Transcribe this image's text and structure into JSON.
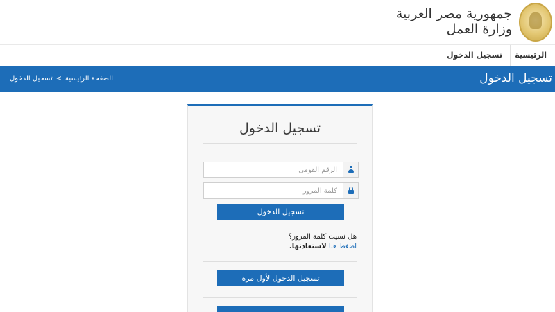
{
  "header": {
    "title_line1": "جمهورية مصر العربية",
    "title_line2": "وزارة العمل"
  },
  "nav": {
    "home": "الرئيسية",
    "login": "تسجيل الدخول"
  },
  "bluebar": {
    "heading": "تسجيل الدخول",
    "breadcrumb": {
      "home": "الصفحة الرئيسية",
      "separator": ">",
      "current": "تسجيل الدخول"
    }
  },
  "login_card": {
    "title": "تسجيل الدخول",
    "national_id": {
      "value": "",
      "placeholder": "الرقم القومى"
    },
    "password": {
      "value": "",
      "placeholder": "كلمة المرور"
    },
    "login_button": "تسجيل الدخول",
    "forgot_text": "هل نسيت كلمة المرور؟",
    "recover_link": "اضغط هنا",
    "recover_text": "لاستعادتها.",
    "first_login_button": "تسجيل الدخول لأول مرة"
  },
  "colors": {
    "primary": "#1d6db8",
    "seal_gold": "#c9a646"
  },
  "icons": {
    "seal": "ministry-seal-icon",
    "id_field": "user-icon",
    "password_field": "lock-icon"
  }
}
